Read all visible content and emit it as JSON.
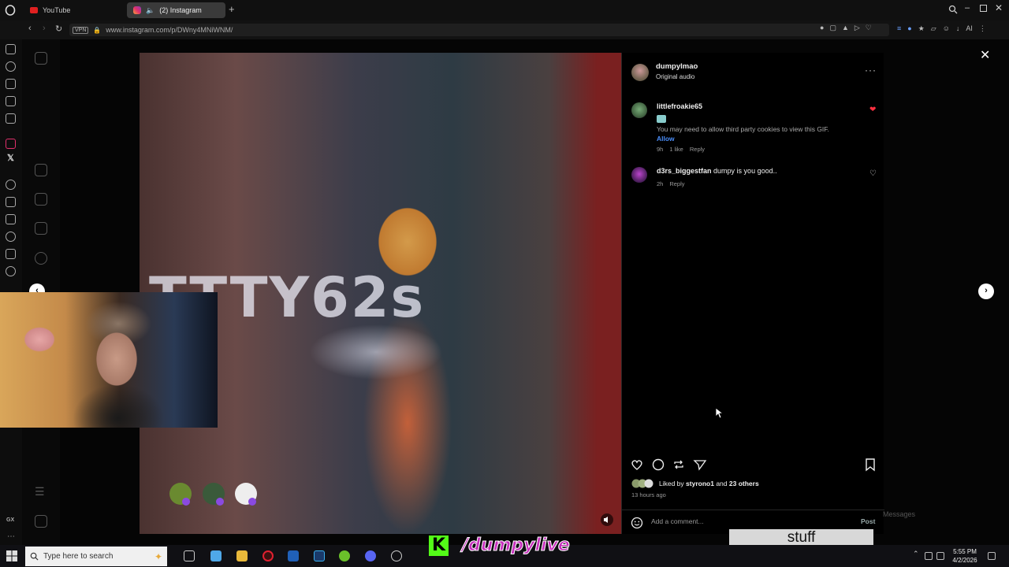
{
  "browser": {
    "tabs": [
      {
        "label": "YouTube",
        "active": false
      },
      {
        "label": "(2) Instagram",
        "active": true
      }
    ],
    "url": "www.instagram.com/p/DWny4MNiWNM/",
    "vpn_label": "VPN",
    "ai_label": "AI"
  },
  "post": {
    "owner": "dumpylmao",
    "audio": "Original audio",
    "media_overlay_text": "TTTY62s",
    "comments": [
      {
        "user": "littlefroakie65",
        "note": "You may need to allow third party cookies to view this GIF.",
        "allow_label": "Allow",
        "time": "9h",
        "likes": "1 like",
        "reply_label": "Reply",
        "liked": true
      },
      {
        "user": "d3rs_biggestfan",
        "text": "dumpy is you good..",
        "time": "2h",
        "reply_label": "Reply",
        "liked": false
      }
    ],
    "liked_by_prefix": "Liked by",
    "liked_by_user": "styrono1",
    "liked_by_and": "and",
    "liked_by_others": "23 others",
    "posted_ago": "13 hours ago",
    "comment_placeholder": "Add a comment...",
    "post_label": "Post"
  },
  "stream": {
    "kick_logo": "K",
    "handle": "/dumpylive",
    "stuff_text": "stuff",
    "messages_ghost": "Messages"
  },
  "taskbar": {
    "search_placeholder": "Type here to search",
    "time": "5:55 PM",
    "date": "4/2/2026"
  },
  "colors": {
    "accent_link": "#4a8df8",
    "liked_heart": "#ff3040",
    "kick_green": "#53fc18",
    "handle_magenta": "#c72fbd"
  }
}
